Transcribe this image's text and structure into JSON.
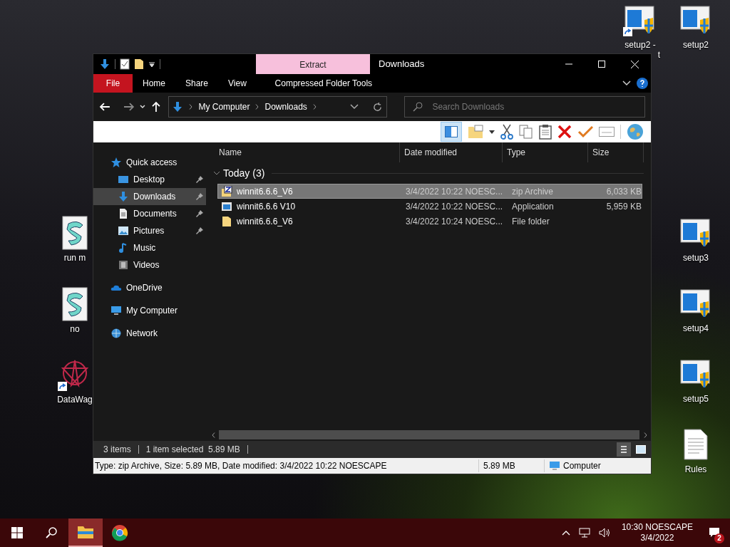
{
  "desktop_icons": [
    {
      "label": "setup2 -",
      "label_line2": "t",
      "kind": "setup",
      "shortcut": true
    },
    {
      "label": "setup2",
      "kind": "setup",
      "shortcut": false
    },
    {
      "label": "setup3",
      "kind": "setup",
      "shortcut": false
    },
    {
      "label": "setup4",
      "kind": "setup",
      "shortcut": false
    },
    {
      "label": "setup5",
      "kind": "setup",
      "shortcut": false
    },
    {
      "label": "Rules",
      "kind": "text",
      "shortcut": false
    },
    {
      "label": "run m",
      "kind": "script",
      "shortcut": false
    },
    {
      "label": "no",
      "kind": "script",
      "shortcut": false
    },
    {
      "label": "DataWag",
      "kind": "app",
      "shortcut": true
    }
  ],
  "window": {
    "title": "Downloads",
    "context_tab": "Extract",
    "ribbon_tabs": [
      {
        "label": "File",
        "kind": "file",
        "selected": false
      },
      {
        "label": "Home",
        "kind": "tab",
        "selected": false
      },
      {
        "label": "Share",
        "kind": "tab",
        "selected": false
      },
      {
        "label": "View",
        "kind": "tab",
        "selected": false
      },
      {
        "label": "Compressed Folder Tools",
        "kind": "context",
        "selected": false
      }
    ],
    "breadcrumb": [
      "My Computer",
      "Downloads"
    ],
    "search": {
      "placeholder": "Search Downloads"
    },
    "sidebar": [
      {
        "label": "Quick access",
        "pinned": false,
        "selected": false
      },
      {
        "label": "Desktop",
        "pinned": true,
        "selected": false
      },
      {
        "label": "Downloads",
        "pinned": true,
        "selected": true
      },
      {
        "label": "Documents",
        "pinned": true,
        "selected": false
      },
      {
        "label": "Pictures",
        "pinned": true,
        "selected": false
      },
      {
        "label": "Music",
        "pinned": false,
        "selected": false
      },
      {
        "label": "Videos",
        "pinned": false,
        "selected": false
      },
      {
        "label": "OneDrive",
        "pinned": false,
        "selected": false
      },
      {
        "label": "My Computer",
        "pinned": false,
        "selected": false
      },
      {
        "label": "Network",
        "pinned": false,
        "selected": false
      }
    ],
    "columns": [
      "Name",
      "Date modified",
      "Type",
      "Size"
    ],
    "group": {
      "label": "Today (3)",
      "expanded": true
    },
    "files": [
      {
        "name": "winnit6.6.6_V6",
        "date": "3/4/2022 10:22 NOESC...",
        "type": "zip Archive",
        "size": "6,033 KB",
        "kind": "zip",
        "selected": true
      },
      {
        "name": "winnit6.6.6 V10",
        "date": "3/4/2022 10:22 NOESC...",
        "type": "Application",
        "size": "5,959 KB",
        "kind": "app",
        "selected": false
      },
      {
        "name": "winnit6.6.6_V6",
        "date": "3/4/2022 10:24 NOESC...",
        "type": "File folder",
        "kind": "folder",
        "selected": false
      }
    ],
    "status": {
      "items": "3 items",
      "selection": "1 item selected  5.89 MB"
    },
    "details_bar": {
      "text": "Type: zip Archive, Size: 5.89 MB, Date modified: 3/4/2022 10:22 NOESCAPE",
      "size": "5.89 MB",
      "location": "Computer"
    }
  },
  "taskbar": {
    "apps": [
      {
        "kind": "explorer",
        "active": true
      },
      {
        "kind": "chrome",
        "active": false
      }
    ],
    "time": "10:30 NOESCAPE",
    "date": "3/4/2022",
    "notifications": "2"
  }
}
